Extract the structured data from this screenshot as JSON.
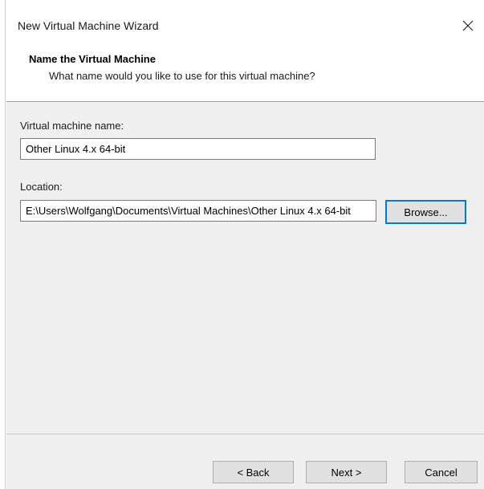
{
  "window": {
    "title": "New Virtual Machine Wizard"
  },
  "header": {
    "title": "Name the Virtual Machine",
    "subtitle": "What name would you like to use for this virtual machine?"
  },
  "form": {
    "vm_name_label": "Virtual machine name:",
    "vm_name_value": "Other Linux 4.x 64-bit",
    "location_label": "Location:",
    "location_value": "E:\\Users\\Wolfgang\\Documents\\Virtual Machines\\Other Linux 4.x 64-bit",
    "browse_label": "Browse..."
  },
  "footer": {
    "back_label": "< Back",
    "next_label": "Next >",
    "cancel_label": "Cancel"
  },
  "icons": {
    "close": "close-icon"
  },
  "colors": {
    "dialog_background": "#f0f0f0",
    "header_background": "#ffffff",
    "focus_border": "#0078d7"
  }
}
